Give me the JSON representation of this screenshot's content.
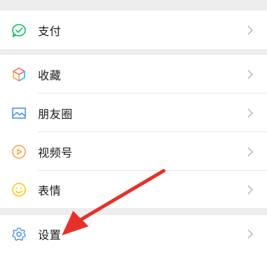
{
  "menu": {
    "pay": {
      "label": "支付",
      "icon": "wechat-pay-icon"
    },
    "favorites": {
      "label": "收藏",
      "icon": "favorites-cube-icon"
    },
    "moments": {
      "label": "朋友圈",
      "icon": "moments-image-icon"
    },
    "channels": {
      "label": "视频号",
      "icon": "channels-play-icon"
    },
    "stickers": {
      "label": "表情",
      "icon": "sticker-smile-icon"
    },
    "settings": {
      "label": "设置",
      "icon": "gear-icon"
    }
  },
  "colors": {
    "pay_green": "#07c160",
    "favorites_cube": [
      "#fa9d3b",
      "#10aeff",
      "#f85959"
    ],
    "moments_blue": "#3d8be8",
    "channels_orange": "#fa9d3b",
    "stickers_yellow": "#ffc300",
    "settings_blue": "#3d8be8",
    "arrow_red": "#e8302a",
    "chevron_gray": "#b2b2b2"
  }
}
